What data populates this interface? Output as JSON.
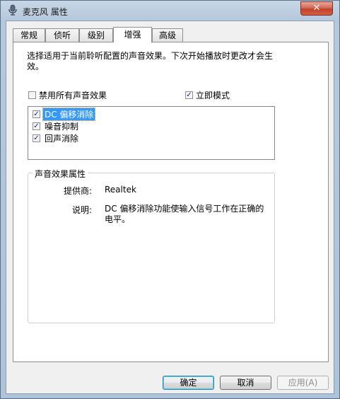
{
  "window": {
    "title": "麦克风 属性",
    "close_label": "✕"
  },
  "tabs": [
    {
      "label": "常规",
      "active": false
    },
    {
      "label": "侦听",
      "active": false
    },
    {
      "label": "级别",
      "active": false
    },
    {
      "label": "增强",
      "active": true
    },
    {
      "label": "高级",
      "active": false
    }
  ],
  "panel": {
    "description": "选择适用于当前聆听配置的声音效果。下次开始播放时更改才会生效。",
    "disable_all": {
      "label": "禁用所有声音效果",
      "checked": false
    },
    "immediate_mode": {
      "label": "立即模式",
      "checked": true
    },
    "effects": [
      {
        "label": "DC 偏移消除",
        "checked": true,
        "selected": true
      },
      {
        "label": "噪音抑制",
        "checked": true,
        "selected": false
      },
      {
        "label": "回声消除",
        "checked": true,
        "selected": false
      }
    ],
    "properties": {
      "group_title": "声音效果属性",
      "provider_label": "提供商:",
      "provider_value": "Realtek",
      "description_label": "说明:",
      "description_value": "DC 偏移消除功能使输入信号工作在正确的电平。"
    }
  },
  "buttons": {
    "ok": "确定",
    "cancel": "取消",
    "apply": "应用(A)"
  }
}
